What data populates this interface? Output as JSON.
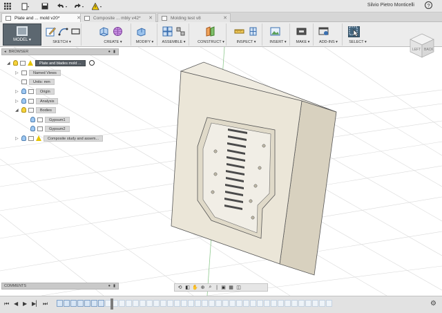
{
  "app": {
    "user_name": "Silvio Pietro Monticelli",
    "help_label": "?"
  },
  "tabs": [
    {
      "label": "Plate and ... mold v20*",
      "active": true
    },
    {
      "label": "Composite ... mbly v42*",
      "active": false
    },
    {
      "label": "Molding test v8",
      "active": false
    }
  ],
  "toolbar": {
    "workspace_label": "MODEL",
    "groups": [
      {
        "label": "SKETCH"
      },
      {
        "label": "CREATE"
      },
      {
        "label": "MODIFY"
      },
      {
        "label": "ASSEMBLE"
      },
      {
        "label": "CONSTRUCT"
      },
      {
        "label": "INSPECT"
      },
      {
        "label": "INSERT"
      },
      {
        "label": "MAKE"
      },
      {
        "label": "ADD-INS"
      },
      {
        "label": "SELECT"
      }
    ]
  },
  "viewcube": {
    "face_label": "LEFT",
    "face_label_2": "BACK"
  },
  "browser": {
    "title": "BROWSER",
    "root_label": "Plate and blades mold ...",
    "items": [
      {
        "label": "Named Views"
      },
      {
        "label": "Units: mm"
      },
      {
        "label": "Origin"
      },
      {
        "label": "Analysis"
      },
      {
        "label": "Bodies"
      },
      {
        "label": "Gypsum1"
      },
      {
        "label": "Gypsum2"
      },
      {
        "label": "Composite study and assem..."
      }
    ]
  },
  "comments": {
    "title": "COMMENTS"
  },
  "colors": {
    "accent": "#44657d",
    "mold_face": "#e9e4d6",
    "mold_side": "#d6cfbd"
  }
}
